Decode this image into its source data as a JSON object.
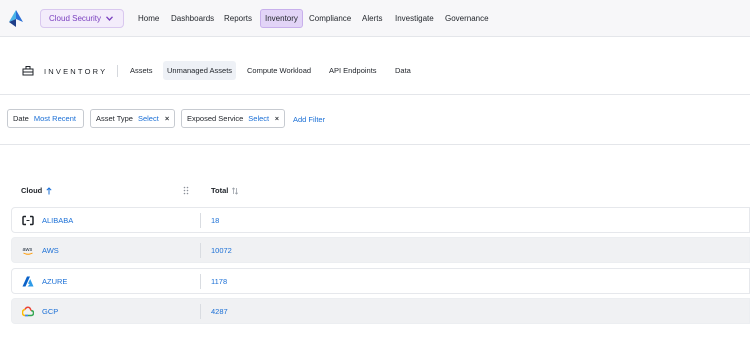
{
  "topnav": {
    "scope_label": "Cloud Security",
    "items": [
      {
        "label": "Home"
      },
      {
        "label": "Dashboards"
      },
      {
        "label": "Reports"
      },
      {
        "label": "Inventory",
        "active": true
      },
      {
        "label": "Compliance"
      },
      {
        "label": "Alerts"
      },
      {
        "label": "Investigate"
      },
      {
        "label": "Governance"
      }
    ]
  },
  "subnav": {
    "section_label": "INVENTORY",
    "tabs": [
      {
        "label": "Assets"
      },
      {
        "label": "Unmanaged Assets",
        "active": true
      },
      {
        "label": "Compute Workload"
      },
      {
        "label": "API Endpoints"
      },
      {
        "label": "Data"
      }
    ]
  },
  "filters": {
    "chips": [
      {
        "key": "Date",
        "value": "Most Recent",
        "removable": false
      },
      {
        "key": "Asset Type",
        "value": "Select",
        "removable": true
      },
      {
        "key": "Exposed Service",
        "value": "Select",
        "removable": true
      }
    ],
    "add_filter_label": "Add Filter"
  },
  "table": {
    "columns": [
      {
        "label": "Cloud",
        "sort": "ascending"
      },
      {
        "label": "Total",
        "sort": "none"
      }
    ],
    "rows": [
      {
        "cloud": "ALIBABA",
        "icon": "alibaba-icon",
        "total": "18"
      },
      {
        "cloud": "AWS",
        "icon": "aws-icon",
        "total": "10072"
      },
      {
        "cloud": "AZURE",
        "icon": "azure-icon",
        "total": "1178"
      },
      {
        "cloud": "GCP",
        "icon": "gcp-icon",
        "total": "4287"
      }
    ]
  },
  "colors": {
    "accent": "#7a3fbf",
    "link": "#1a6fd6",
    "nav_active_bg": "#e2d4f7"
  }
}
